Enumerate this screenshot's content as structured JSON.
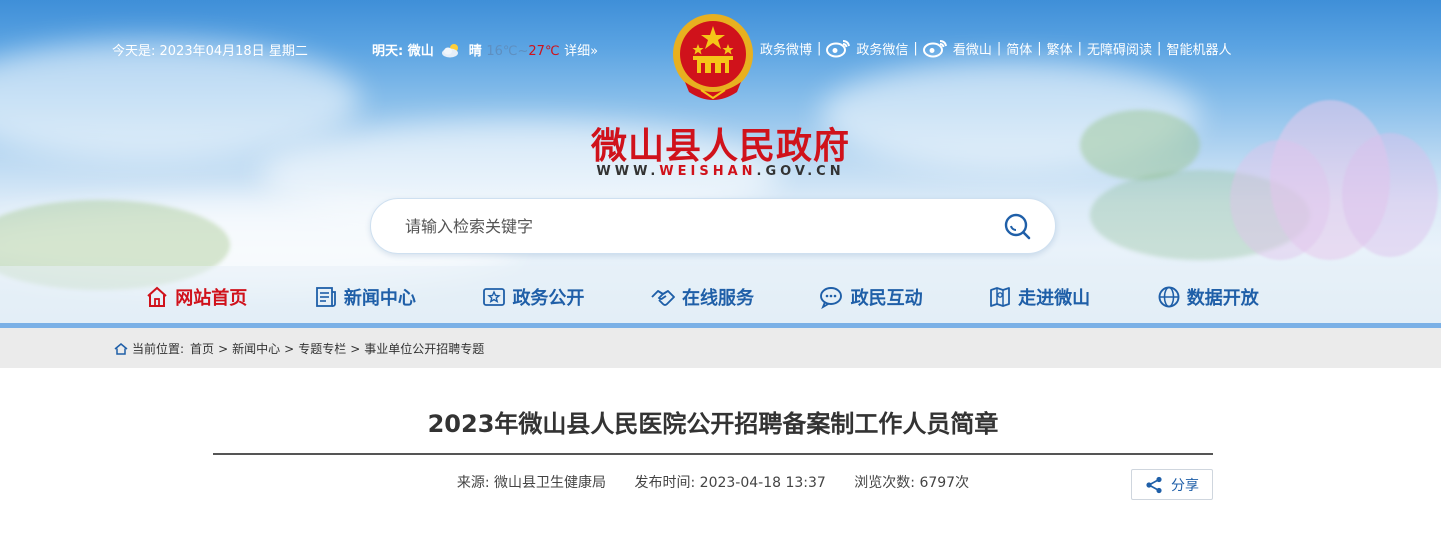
{
  "topbar": {
    "today": "今天是:  2023年04月18日 星期二",
    "weather_label": "明天: 微山",
    "weather_cond": "晴",
    "temp_low": "16℃",
    "temp_sep": "~",
    "temp_high": "27℃",
    "weather_more": "详细»",
    "links": [
      "政务微博",
      "政务微信",
      "看微山",
      "简体",
      "繁体",
      "无障碍阅读",
      "智能机器人"
    ]
  },
  "site": {
    "name": "微山县人民政府",
    "domain_prefix": "WWW.",
    "domain_red": "WEISHAN",
    "domain_suffix": ".GOV.CN"
  },
  "search": {
    "placeholder": "请输入检索关键字"
  },
  "nav": {
    "items": [
      {
        "label": "网站首页",
        "icon": "home-icon"
      },
      {
        "label": "新闻中心",
        "icon": "newspaper-icon"
      },
      {
        "label": "政务公开",
        "icon": "document-star-icon"
      },
      {
        "label": "在线服务",
        "icon": "handshake-icon"
      },
      {
        "label": "政民互动",
        "icon": "chat-icon"
      },
      {
        "label": "走进微山",
        "icon": "map-icon"
      },
      {
        "label": "数据开放",
        "icon": "globe-icon"
      }
    ]
  },
  "breadcrumb": {
    "label": "当前位置:",
    "items": [
      "首页",
      "新闻中心",
      "专题专栏",
      "事业单位公开招聘专题"
    ]
  },
  "article": {
    "title": "2023年微山县人民医院公开招聘备案制工作人员简章",
    "source": "来源: 微山县卫生健康局",
    "published": "发布时间: 2023-04-18 13:37",
    "views": "浏览次数: 6797次",
    "share_label": "分享"
  },
  "colors": {
    "brand_red": "#d0121b",
    "nav_blue": "#1f5fa8"
  }
}
